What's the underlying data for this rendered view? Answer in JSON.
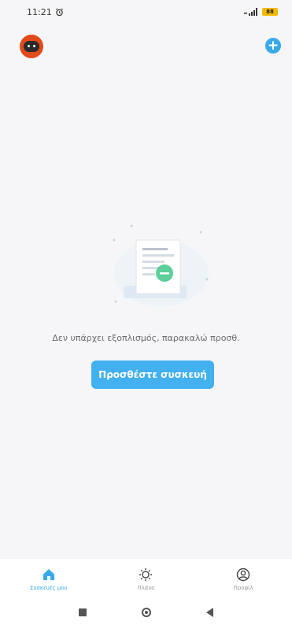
{
  "status_bar": {
    "time": "11:21",
    "alarm_icon": "alarm-clock-icon",
    "battery": "88"
  },
  "header": {
    "avatar_icon": "robot-avatar-icon",
    "add_icon": "plus-circle-icon"
  },
  "empty_state": {
    "illustration_icon": "empty-document-icon",
    "message": "Δεν υπάρχει εξοπλισμός, παρακαλώ προσθ.",
    "add_button_label": "Προσθέστε συσκευή"
  },
  "bottom_nav": {
    "items": [
      {
        "label": "Συσκευές μου",
        "icon": "home-icon",
        "active": true
      },
      {
        "label": "Πλάνο",
        "icon": "sun-icon",
        "active": false
      },
      {
        "label": "Προφίλ",
        "icon": "user-circle-icon",
        "active": false
      }
    ]
  },
  "system_nav": {
    "recents_icon": "square-icon",
    "home_icon": "circle-icon",
    "back_icon": "back-triangle-icon"
  },
  "colors": {
    "accent": "#38a9ea",
    "button": "#43b0ef",
    "avatar": "#e24a1a",
    "background": "#f6f6f8"
  }
}
